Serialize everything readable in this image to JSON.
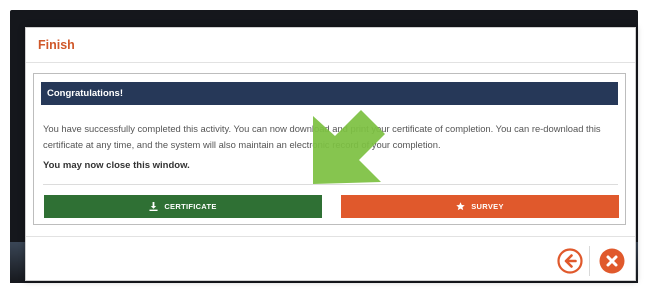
{
  "modal": {
    "title": "Finish",
    "banner": "Congratulations!",
    "message": "You have successfully completed this activity. You can now download and print your certificate of completion. You can re-download this certificate at any time, and the system will also maintain an electronic record of your completion.",
    "close_note": "You may now close this window.",
    "certificate_button": "CERTIFICATE",
    "survey_button": "SURVEY"
  },
  "icons": {
    "certificate": "download-icon",
    "survey": "star-icon",
    "back": "arrow-left-circle-icon",
    "close": "close-circle-icon",
    "annotation": "green-arrow-annotation"
  },
  "colors": {
    "title": "#d0582a",
    "banner": "#263858",
    "certificate_button": "#2f7034",
    "survey_button": "#e0592c",
    "annotation_arrow": "#7dc142"
  }
}
